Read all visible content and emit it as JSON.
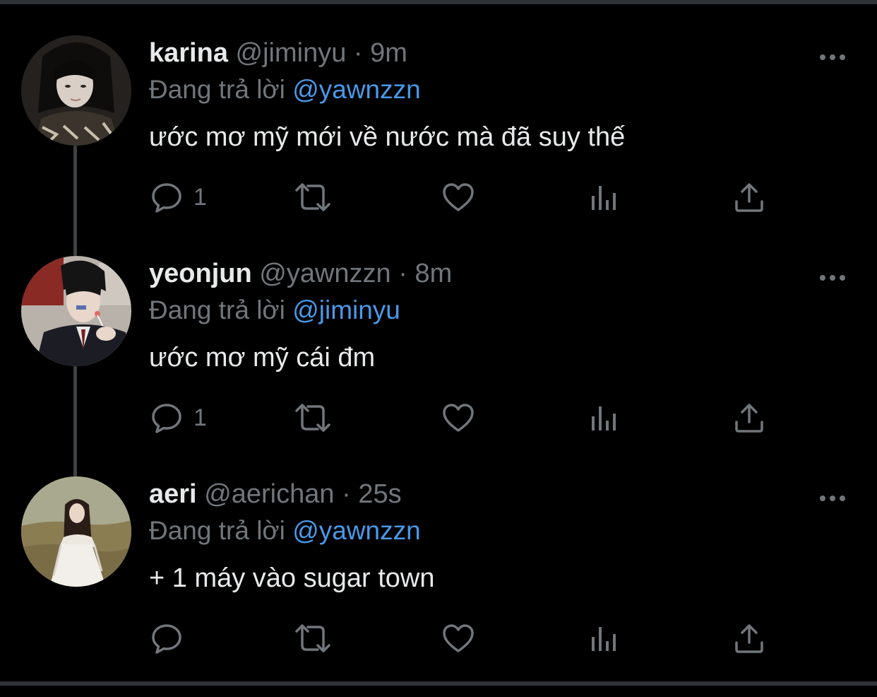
{
  "colors": {
    "background": "#000000",
    "text_primary": "#e7e9ea",
    "text_secondary": "#71767b",
    "mention": "#4a99e9"
  },
  "tweets": [
    {
      "name": "karina",
      "handle": "@jiminyu",
      "dot": "·",
      "time": "9m",
      "reply_prefix": "Đang trả lời",
      "reply_to": "@yawnzzn",
      "text": "ước mơ mỹ mới về nước mà đã suy thế",
      "reply_count": "1",
      "avatar_icon": "profile-photo"
    },
    {
      "name": "yeonjun",
      "handle": "@yawnzzn",
      "dot": "·",
      "time": "8m",
      "reply_prefix": "Đang trả lời",
      "reply_to": "@jiminyu",
      "text": "ước mơ mỹ cái đm",
      "reply_count": "1",
      "avatar_icon": "profile-photo"
    },
    {
      "name": "aeri",
      "handle": "@aerichan",
      "dot": "·",
      "time": "25s",
      "reply_prefix": "Đang trả lời",
      "reply_to": "@yawnzzn",
      "text": "+ 1 máy vào sugar town",
      "reply_count": "",
      "avatar_icon": "profile-photo"
    }
  ],
  "icons": {
    "reply": "speech-bubble-icon",
    "retweet": "retweet-arrows-icon",
    "like": "heart-icon",
    "views": "bar-chart-icon",
    "share": "upload-arrow-icon",
    "more": "three-dots-icon"
  }
}
